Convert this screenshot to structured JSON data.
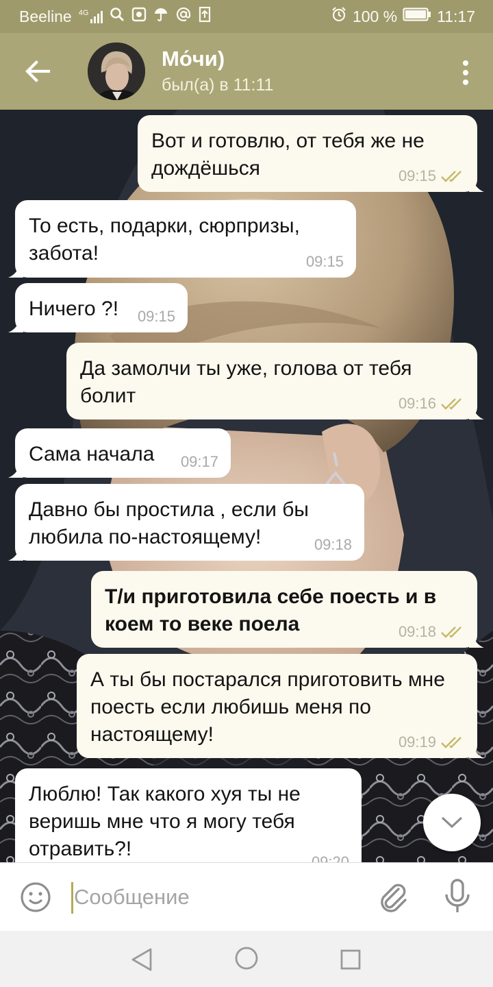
{
  "status_bar": {
    "carrier": "Beeline",
    "network": "4G",
    "battery": "100 %",
    "time": "11:17",
    "icons": [
      "signal-icon",
      "search-icon",
      "gallery-icon",
      "umbrella-icon",
      "at-icon",
      "upload-icon",
      "alarm-icon",
      "battery-icon"
    ]
  },
  "header": {
    "contact_name": "Мо́чи)",
    "last_seen": "был(а) в 11:11"
  },
  "messages": [
    {
      "direction": "out",
      "text": "Вот и готовлю, от тебя же не дождёшься",
      "time": "09:15",
      "read": true
    },
    {
      "direction": "in",
      "text": "То есть, подарки, сюрпризы, забота!",
      "time": "09:15"
    },
    {
      "direction": "in",
      "text": "Ничего ?!",
      "time": "09:15"
    },
    {
      "direction": "out",
      "text": "Да замолчи ты уже, голова от тебя болит",
      "time": "09:16",
      "read": true
    },
    {
      "direction": "in",
      "text": "Сама начала",
      "time": "09:17"
    },
    {
      "direction": "in",
      "text": "Давно бы простила , если бы любила по-настоящему!",
      "time": "09:18"
    },
    {
      "direction": "out",
      "text": "Т/и приготовила себе поесть и в коем то веке поела",
      "time": "09:18",
      "read": true,
      "bold": true
    },
    {
      "direction": "out",
      "text": "А ты бы постарался приготовить мне поесть если любишь меня по настоящему!",
      "time": "09:19",
      "read": true
    },
    {
      "direction": "in",
      "text": "Люблю! Так какого хуя ты не веришь мне что я могу тебя отравить?!",
      "time": "09:20"
    }
  ],
  "input": {
    "placeholder": "Сообщение",
    "value": ""
  },
  "colors": {
    "header": "#aba677",
    "status_bar": "#9f9a6c",
    "outgoing_bubble": "#fcf9ee",
    "incoming_bubble": "#ffffff",
    "read_check": "#c4b968"
  }
}
